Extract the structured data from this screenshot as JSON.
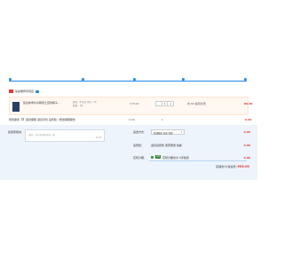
{
  "steps": {
    "labels": [
      "",
      "",
      "",
      "",
      ""
    ]
  },
  "store": {
    "name": "某某服饰专营店",
    "badge_color": "#e53935"
  },
  "item": {
    "title": "复古休闲牛仔裤男士直筒裤子...",
    "sku_line1": "颜色：牛仔蓝 尺码：30",
    "sku_line2": "数量：1件",
    "price": "179.00",
    "qty_minus": "-",
    "qty_value": "1",
    "qty_plus": "+",
    "discount": "省:80 超值优惠",
    "subtotal": "89.00"
  },
  "service": {
    "label": "增值服务",
    "text": "退货保障 退货无忧 运费险 / 赠送保障服务",
    "price": "0.00",
    "qty": "1",
    "total": "0.00"
  },
  "panel": {
    "msg_label": "给卖家留言：",
    "msg_placeholder": "选填，请先和商家协商一致",
    "msg_count": "0/200",
    "delivery_label": "运送方式：",
    "delivery_select": "普通配送 快递 免邮",
    "delivery_amt": "0.00",
    "shipping_label": "运费险：",
    "shipping_text": "退货运费险 卖家赠送 免邮",
    "shipping_amt": "0.00",
    "huabei_label": "花呗分期：",
    "huabei_badge": "花呗",
    "huabei_text": "花呗分期支付 0手续费",
    "huabei_amt": "0.00",
    "total_label": "店铺合计(含运费)",
    "total_value": "¥56.00"
  },
  "colors": {
    "accent": "#1e88e5",
    "price_red": "#e53935",
    "panel_bg": "#eef4fb"
  }
}
